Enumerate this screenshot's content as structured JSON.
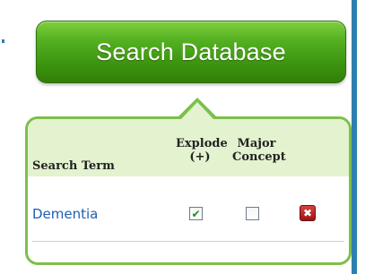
{
  "search_button": {
    "label": "Search Database"
  },
  "table": {
    "headers": {
      "term": "Search Term",
      "explode_line1": "Explode",
      "explode_line2": "(+)",
      "major_line1": "Major",
      "major_line2": "Concept"
    },
    "rows": [
      {
        "term": "Dementia",
        "explode": true,
        "major_concept": false,
        "delete_icon": "delete-x-icon"
      }
    ]
  },
  "colors": {
    "button_green": "#3c940f",
    "panel_border": "#7cc04a",
    "header_bg": "#e3f2cf",
    "link_blue": "#1f5fb3",
    "delete_red": "#b41e1e"
  }
}
